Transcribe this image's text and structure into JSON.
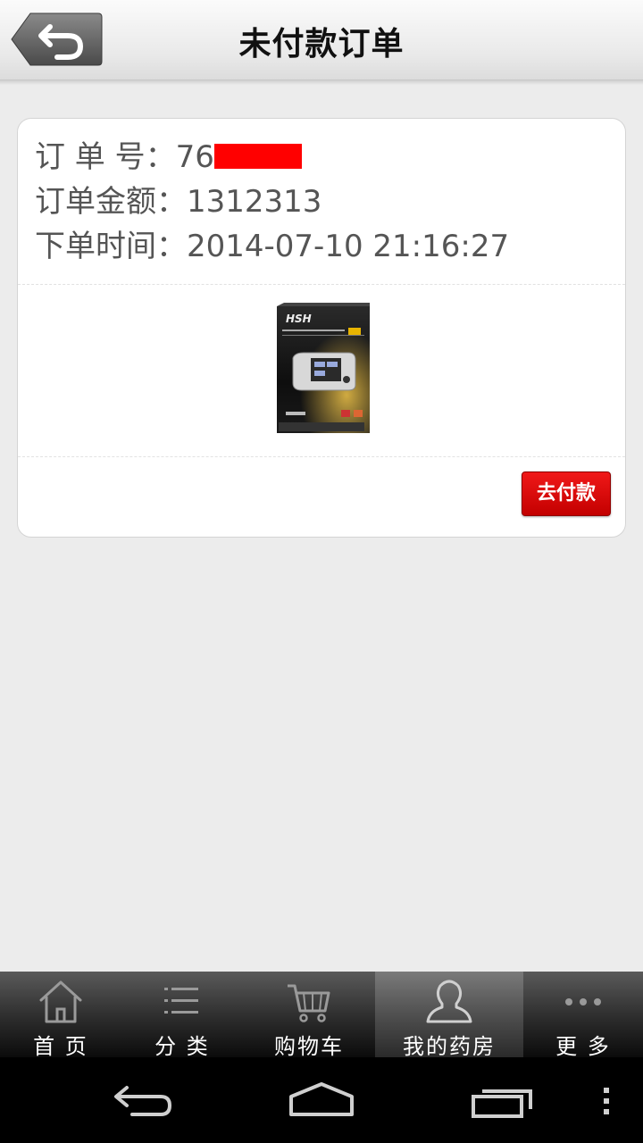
{
  "header": {
    "title": "未付款订单",
    "back_icon": "back-arrow-icon"
  },
  "order": {
    "number_label": "订 单 号：",
    "number_value": "76",
    "amount_label": "订单金额：",
    "amount_value": "1312313",
    "time_label": "下单时间：",
    "time_value": "2014-07-10 21:16:27",
    "product_image": "blood-pressure-monitor-product-image",
    "pay_button": "去付款",
    "pay_button_color": "#e00000"
  },
  "tabbar": {
    "tabs": [
      {
        "label": "首 页",
        "icon": "home-icon",
        "active": false
      },
      {
        "label": "分 类",
        "icon": "list-icon",
        "active": false
      },
      {
        "label": "购物车",
        "icon": "cart-icon",
        "active": false
      },
      {
        "label": "我的药房",
        "icon": "user-icon",
        "active": true
      },
      {
        "label": "更 多",
        "icon": "more-icon",
        "active": false
      }
    ]
  },
  "system_nav": {
    "buttons": [
      "back-icon",
      "home-icon",
      "recent-apps-icon",
      "menu-icon"
    ]
  }
}
